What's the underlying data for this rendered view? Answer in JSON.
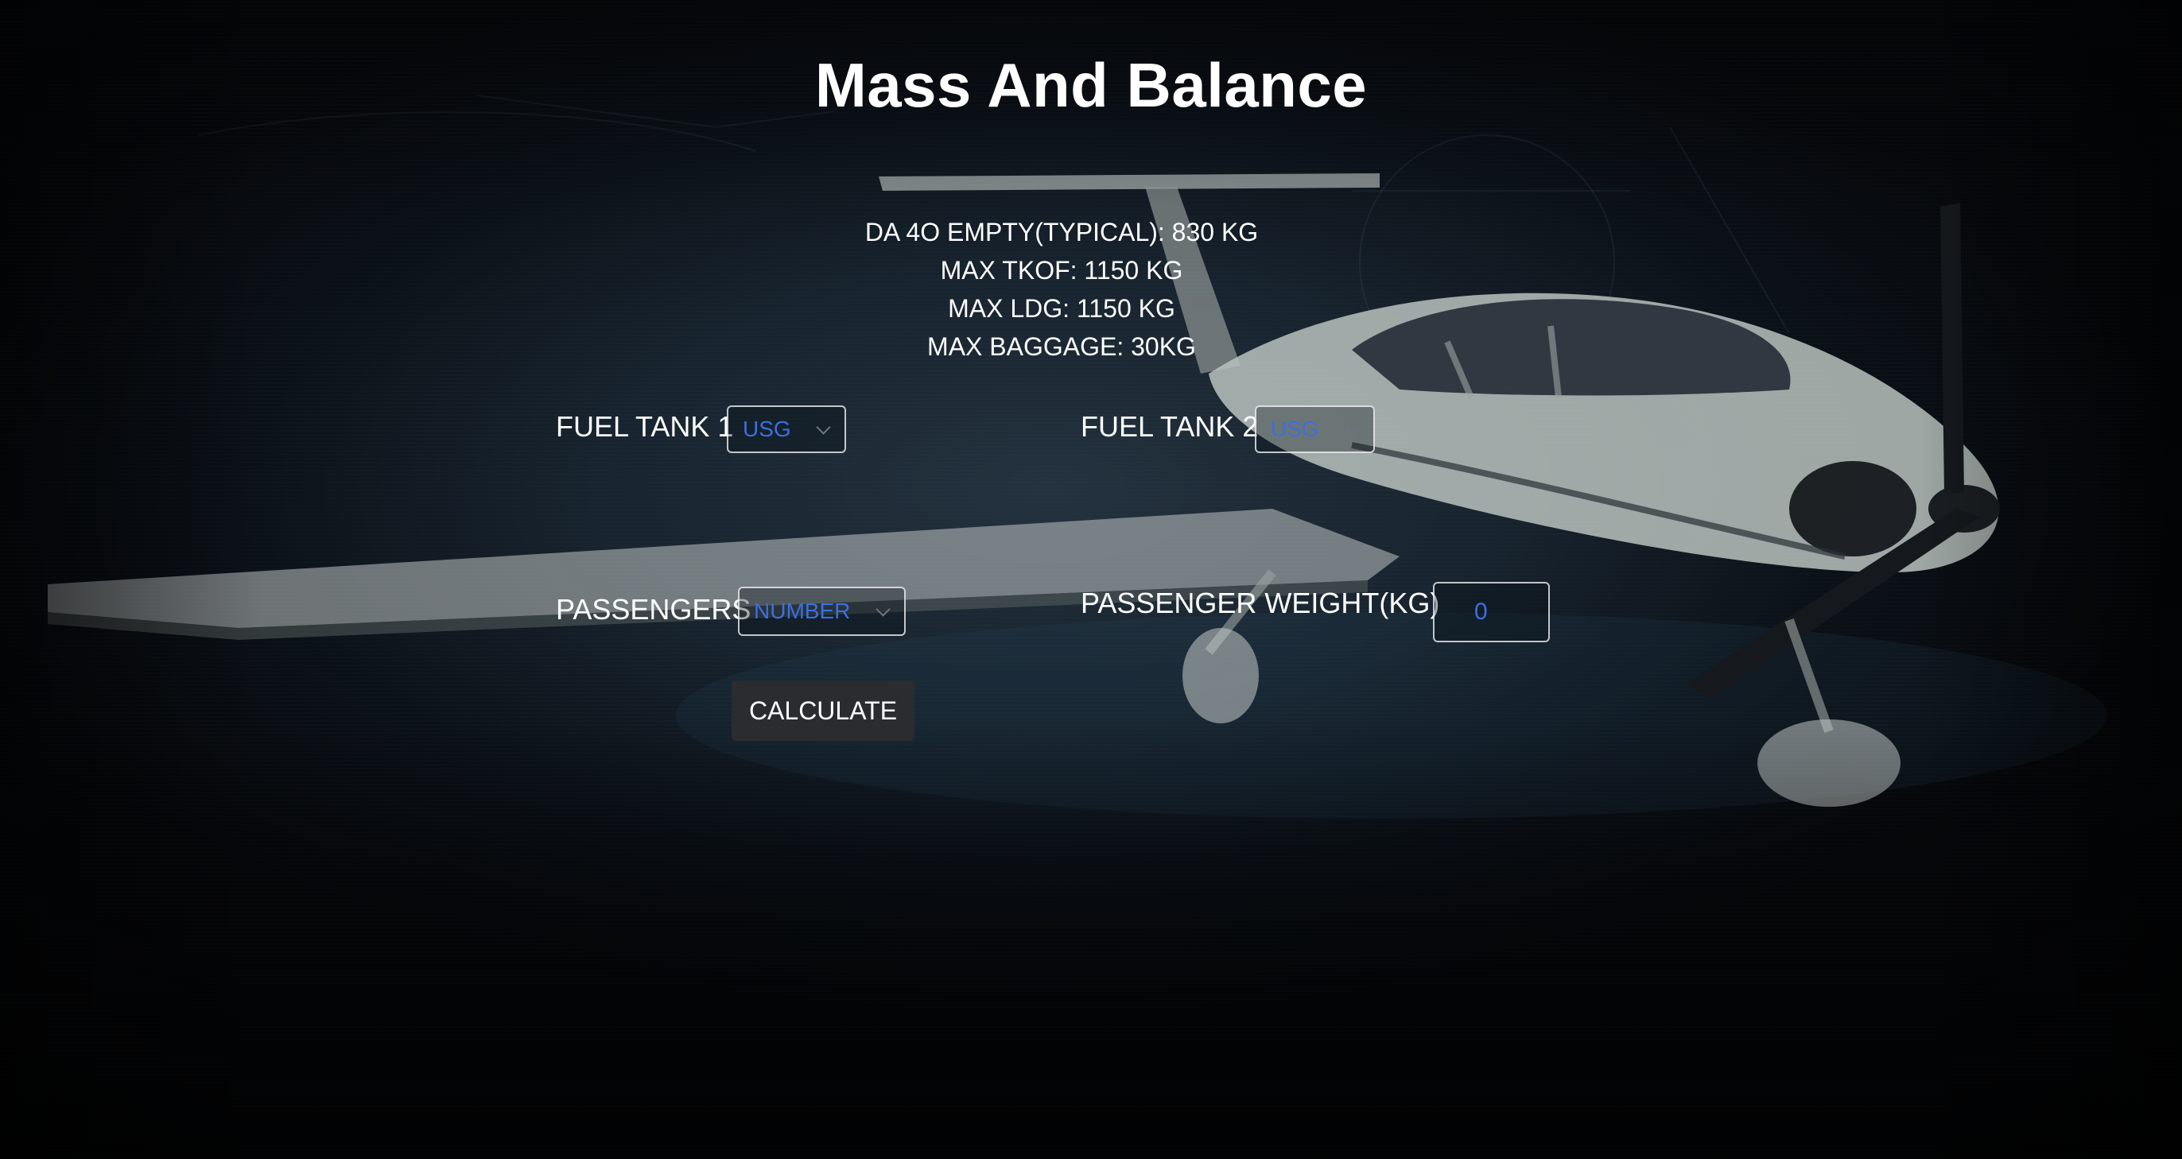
{
  "page": {
    "title": "Mass And Balance"
  },
  "aircraft_info": [
    "DA 4O EMPTY(TYPICAL): 830 KG",
    "MAX TKOF: 1150 KG",
    "MAX LDG: 1150 KG",
    "MAX BAGGAGE: 30KG"
  ],
  "form": {
    "fuel_tank_1": {
      "label": "FUEL TANK 1",
      "selected": "USG"
    },
    "fuel_tank_2": {
      "label": "FUEL TANK 2",
      "selected": "USG"
    },
    "passengers": {
      "label": "PASSENGERS",
      "selected": "NUMBER"
    },
    "passenger_weight": {
      "label": "PASSENGER WEIGHT(KG)",
      "value": "0"
    },
    "calculate_label": "CALCULATE"
  },
  "colors": {
    "background": "#05070a",
    "text": "#ffffff",
    "control_text": "#3b6fe0",
    "button_bg": "#2a2c30"
  },
  "icons": [
    "chevron-down-icon"
  ]
}
